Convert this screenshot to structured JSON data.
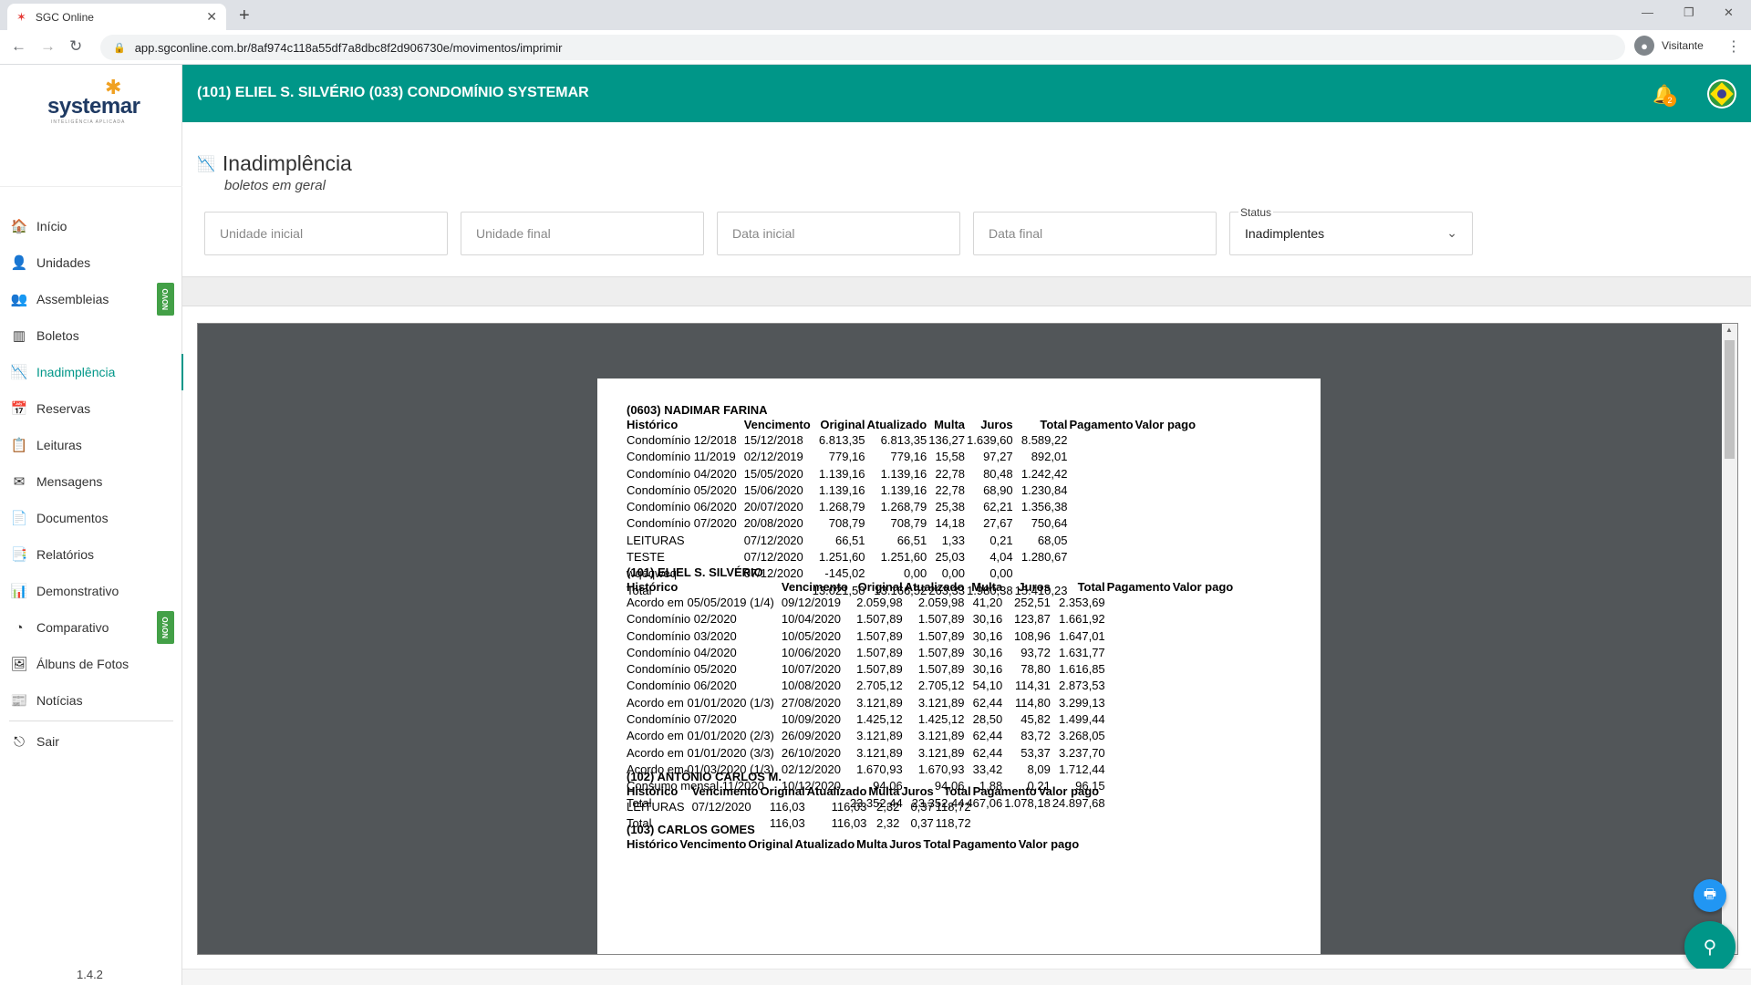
{
  "browser": {
    "tab_title": "SGC Online",
    "url": "app.sgconline.com.br/8af974c118a55df7a8dbc8f2d906730e/movimentos/imprimir",
    "profile_label": "Visitante"
  },
  "header": {
    "title": "(101) ELIEL S. SILVÉRIO  (033) CONDOMÍNIO SYSTEMAR",
    "notification_count": "2"
  },
  "brand": {
    "logo_text": "systemar",
    "logo_tagline": "INTELIGÊNCIA APLICADA"
  },
  "sidebar": {
    "items": [
      {
        "label": "Início",
        "icon": "home-icon",
        "glyph": "🏠"
      },
      {
        "label": "Unidades",
        "icon": "user-icon",
        "glyph": "👤"
      },
      {
        "label": "Assembleias",
        "icon": "meeting-icon",
        "glyph": "👥",
        "badge": "NOVO"
      },
      {
        "label": "Boletos",
        "icon": "barcode-icon",
        "glyph": "▥"
      },
      {
        "label": "Inadimplência",
        "icon": "chart-down-icon",
        "glyph": "📉",
        "active": true
      },
      {
        "label": "Reservas",
        "icon": "calendar-icon",
        "glyph": "📅"
      },
      {
        "label": "Leituras",
        "icon": "checklist-icon",
        "glyph": "📋"
      },
      {
        "label": "Mensagens",
        "icon": "envelope-icon",
        "glyph": "✉"
      },
      {
        "label": "Documentos",
        "icon": "document-icon",
        "glyph": "📄"
      },
      {
        "label": "Relatórios",
        "icon": "report-icon",
        "glyph": "📑"
      },
      {
        "label": "Demonstrativo",
        "icon": "bar-chart-icon",
        "glyph": "📊"
      },
      {
        "label": "Comparativo",
        "icon": "pie-chart-icon",
        "glyph": "◔",
        "badge": "NOVO"
      },
      {
        "label": "Álbuns de Fotos",
        "icon": "photo-icon",
        "glyph": "🖼"
      },
      {
        "label": "Notícias",
        "icon": "news-icon",
        "glyph": "📰"
      }
    ],
    "logout_label": "Sair",
    "version": "1.4.2"
  },
  "page": {
    "title": "Inadimplência",
    "subtitle": "boletos em geral"
  },
  "filters": {
    "unidade_inicial_placeholder": "Unidade inicial",
    "unidade_final_placeholder": "Unidade final",
    "data_inicial_placeholder": "Data inicial",
    "data_final_placeholder": "Data final",
    "status_label": "Status",
    "status_value": "Inadimplentes"
  },
  "report": {
    "headers": [
      "Histórico",
      "Vencimento",
      "Original",
      "Atualizado",
      "Multa",
      "Juros",
      "Total",
      "Pagamento",
      "Valor pago"
    ],
    "sections": [
      {
        "name": "(0603) NADIMAR FARINA",
        "rows": [
          [
            "Condomínio 12/2018",
            "15/12/2018",
            "6.813,35",
            "6.813,35",
            "136,27",
            "1.639,60",
            "8.589,22"
          ],
          [
            "Condomínio 11/2019",
            "02/12/2019",
            "779,16",
            "779,16",
            "15,58",
            "97,27",
            "892,01"
          ],
          [
            "Condomínio 04/2020",
            "15/05/2020",
            "1.139,16",
            "1.139,16",
            "22,78",
            "80,48",
            "1.242,42"
          ],
          [
            "Condomínio 05/2020",
            "15/06/2020",
            "1.139,16",
            "1.139,16",
            "22,78",
            "68,90",
            "1.230,84"
          ],
          [
            "Condomínio 06/2020",
            "20/07/2020",
            "1.268,79",
            "1.268,79",
            "25,38",
            "62,21",
            "1.356,38"
          ],
          [
            "Condomínio 07/2020",
            "20/08/2020",
            "708,79",
            "708,79",
            "14,18",
            "27,67",
            "750,64"
          ],
          [
            "LEITURAS",
            "07/12/2020",
            "66,51",
            "66,51",
            "1,33",
            "0,21",
            "68,05"
          ],
          [
            "TESTE",
            "07/12/2020",
            "1.251,60",
            "1.251,60",
            "25,03",
            "4,04",
            "1.280,67"
          ],
          [
            "wqeqweq",
            "07/12/2020",
            "-145,02",
            "0,00",
            "0,00",
            "0,00",
            ""
          ]
        ],
        "total": [
          "Total",
          "",
          "13.021,50",
          "13.166,52",
          "263,33",
          "1.980,38",
          "15.410,23"
        ]
      },
      {
        "name": "(101) ELIEL S. SILVÉRIO",
        "rows": [
          [
            "Acordo em 05/05/2019 (1/4)",
            "09/12/2019",
            "2.059,98",
            "2.059,98",
            "41,20",
            "252,51",
            "2.353,69"
          ],
          [
            "Condomínio 02/2020",
            "10/04/2020",
            "1.507,89",
            "1.507,89",
            "30,16",
            "123,87",
            "1.661,92"
          ],
          [
            "Condomínio 03/2020",
            "10/05/2020",
            "1.507,89",
            "1.507,89",
            "30,16",
            "108,96",
            "1.647,01"
          ],
          [
            "Condomínio 04/2020",
            "10/06/2020",
            "1.507,89",
            "1.507,89",
            "30,16",
            "93,72",
            "1.631,77"
          ],
          [
            "Condomínio 05/2020",
            "10/07/2020",
            "1.507,89",
            "1.507,89",
            "30,16",
            "78,80",
            "1.616,85"
          ],
          [
            "Condomínio 06/2020",
            "10/08/2020",
            "2.705,12",
            "2.705,12",
            "54,10",
            "114,31",
            "2.873,53"
          ],
          [
            "Acordo em 01/01/2020 (1/3)",
            "27/08/2020",
            "3.121,89",
            "3.121,89",
            "62,44",
            "114,80",
            "3.299,13"
          ],
          [
            "Condomínio 07/2020",
            "10/09/2020",
            "1.425,12",
            "1.425,12",
            "28,50",
            "45,82",
            "1.499,44"
          ],
          [
            "Acordo em 01/01/2020 (2/3)",
            "26/09/2020",
            "3.121,89",
            "3.121,89",
            "62,44",
            "83,72",
            "3.268,05"
          ],
          [
            "Acordo em 01/01/2020 (3/3)",
            "26/10/2020",
            "3.121,89",
            "3.121,89",
            "62,44",
            "53,37",
            "3.237,70"
          ],
          [
            "Acordo em 01/03/2020 (1/3)",
            "02/12/2020",
            "1.670,93",
            "1.670,93",
            "33,42",
            "8,09",
            "1.712,44"
          ],
          [
            "Consumo mensal 11/2020",
            "10/12/2020",
            "94,06",
            "94,06",
            "1,88",
            "0,21",
            "96,15"
          ]
        ],
        "total": [
          "Total",
          "",
          "23.352,44",
          "23.352,44",
          "467,06",
          "1.078,18",
          "24.897,68"
        ]
      },
      {
        "name": "(102) ANTÔNIO CARLOS M.",
        "rows": [
          [
            "LEITURAS",
            "07/12/2020",
            "116,03",
            "116,03",
            "2,32",
            "0,37",
            "118,72"
          ]
        ],
        "total": [
          "Total",
          "",
          "116,03",
          "116,03",
          "2,32",
          "0,37",
          "118,72"
        ]
      },
      {
        "name": "(103) CARLOS GOMES",
        "rows": [],
        "total": null
      }
    ]
  }
}
